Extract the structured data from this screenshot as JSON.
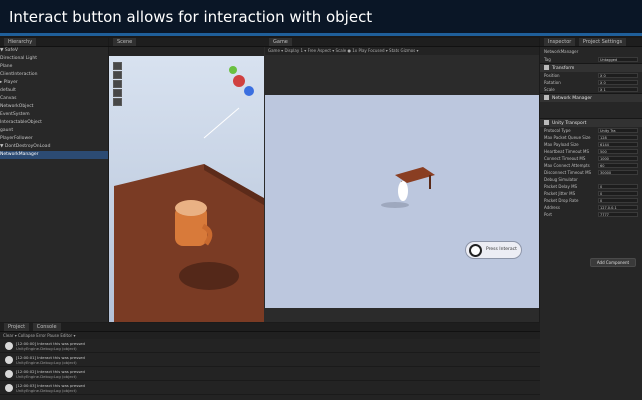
{
  "caption": "Interact button allows for interaction with object",
  "toolbar": {
    "play_icons": [
      "play-icon",
      "pause-icon",
      "step-icon"
    ]
  },
  "hierarchy": {
    "tab": "Hierarchy",
    "items": [
      {
        "label": "▼ SafeV",
        "selected": false
      },
      {
        "label": "    Directional Light",
        "selected": false
      },
      {
        "label": "    Plane",
        "selected": false
      },
      {
        "label": "    ClientInteraction",
        "selected": false
      },
      {
        "label": "  ▸ Player",
        "selected": false
      },
      {
        "label": "      default",
        "selected": false
      },
      {
        "label": "    Canvas",
        "selected": false
      },
      {
        "label": "    NetworkObject",
        "selected": false
      },
      {
        "label": "    EventSystem",
        "selected": false
      },
      {
        "label": "      InteractableObject",
        "selected": false
      },
      {
        "label": "      gaunt",
        "selected": false
      },
      {
        "label": "      PlayerFollower",
        "selected": false
      },
      {
        "label": "▼ DontDestroyOnLoad",
        "selected": false
      },
      {
        "label": "    NetworkManager",
        "selected": true
      }
    ]
  },
  "scene": {
    "tab": "Scene"
  },
  "game": {
    "tab": "Game",
    "bar": "Game  ▾  Display 1  ▾  Free Aspect  ▾  Scale  ●  1x   Play Focused  ▾  Stats  Gizmos  ▾",
    "interact_label": "Press Interact"
  },
  "inspector": {
    "tabs": [
      "Inspector",
      "Project Settings"
    ],
    "object_name": "NetworkManager",
    "tag": "Untagged",
    "transform_title": "Transform",
    "transform_rows": [
      {
        "label": "Position",
        "value": "X 0"
      },
      {
        "label": "Rotation",
        "value": "X 0"
      },
      {
        "label": "Scale",
        "value": "X 1"
      }
    ],
    "network_manager_title": "Network Manager",
    "transport_title": "Unity Transport",
    "transport_rows": [
      {
        "label": "Protocol Type",
        "value": "Unity Tra"
      },
      {
        "label": "Max Packet Queue Size",
        "value": "128"
      },
      {
        "label": "Max Payload Size",
        "value": "6144"
      },
      {
        "label": "Heartbeat Timeout MS",
        "value": "500"
      },
      {
        "label": "Connect Timeout MS",
        "value": "1000"
      },
      {
        "label": "Max Connect Attempts",
        "value": "60"
      },
      {
        "label": "Disconnect Timeout MS",
        "value": "30000"
      }
    ],
    "debug_title": "Debug Simulator",
    "debug_rows": [
      {
        "label": "Packet Delay MS",
        "value": "0"
      },
      {
        "label": "Packet Jitter MS",
        "value": "0"
      },
      {
        "label": "Packet Drop Rate",
        "value": "0"
      }
    ],
    "address_rows": [
      {
        "label": "Address",
        "value": "127.0.0.1"
      },
      {
        "label": "Port",
        "value": "7777"
      }
    ],
    "button_label": "Add Component"
  },
  "console": {
    "tabs": [
      "Project",
      "Console"
    ],
    "toolbar": "Clear  ▾  Collapse   Error Pause   Editor  ▾",
    "rows": [
      {
        "l1": "[12:00:00] Interact this was pressed",
        "l2": "UnityEngine.Debug:Log (object)"
      },
      {
        "l1": "[12:00:01] Interact this was pressed",
        "l2": "UnityEngine.Debug:Log (object)"
      },
      {
        "l1": "[12:00:02] Interact this was pressed",
        "l2": "UnityEngine.Debug:Log (object)"
      },
      {
        "l1": "[12:00:03] Interact this was pressed",
        "l2": "UnityEngine.Debug:Log (object)"
      }
    ]
  },
  "colors": {
    "selection": "#2c4b73",
    "accent": "#1f5f9a",
    "table": "#7a3b24",
    "mug": "#d87a3a"
  }
}
